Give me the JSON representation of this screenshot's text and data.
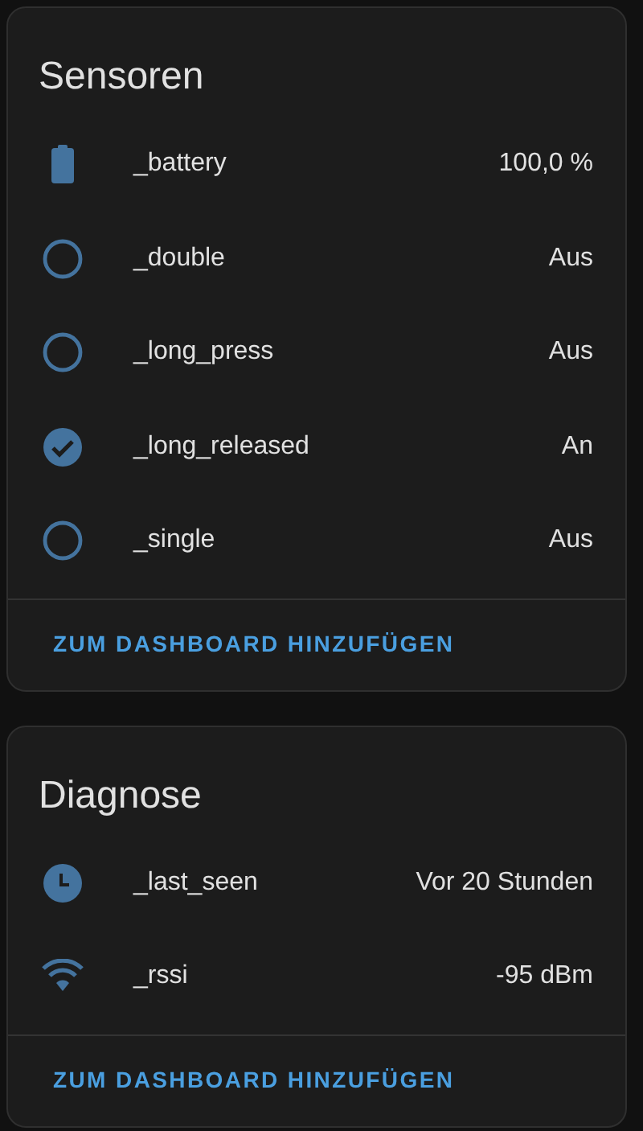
{
  "cards": [
    {
      "title": "Sensoren",
      "rows": [
        {
          "kind": "battery",
          "name": "_battery",
          "value": "100,0 %"
        },
        {
          "kind": "binary",
          "on": false,
          "name": "_double",
          "value": "Aus"
        },
        {
          "kind": "binary",
          "on": false,
          "name": "_long_press",
          "value": "Aus"
        },
        {
          "kind": "binary",
          "on": true,
          "name": "_long_released",
          "value": "An"
        },
        {
          "kind": "binary",
          "on": false,
          "name": "_single",
          "value": "Aus"
        }
      ],
      "action": "ZUM DASHBOARD HINZUFÜGEN"
    },
    {
      "title": "Diagnose",
      "rows": [
        {
          "kind": "clock",
          "name": "_last_seen",
          "value": "Vor 20 Stunden"
        },
        {
          "kind": "signal",
          "name": "_rssi",
          "value": "-95 dBm"
        }
      ],
      "action": "ZUM DASHBOARD HINZUFÜGEN"
    }
  ]
}
